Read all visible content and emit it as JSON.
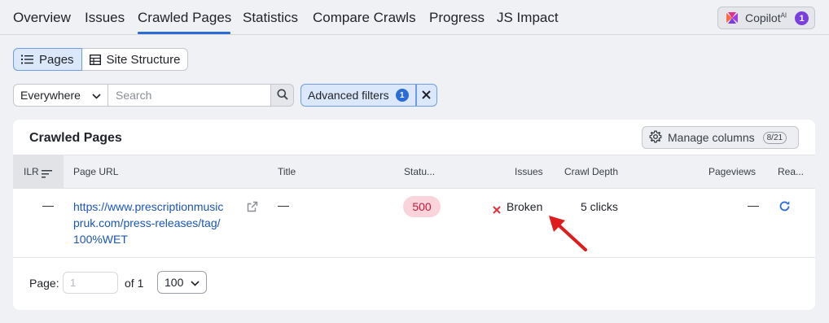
{
  "nav": {
    "tabs": [
      {
        "label": "Overview"
      },
      {
        "label": "Issues"
      },
      {
        "label": "Crawled Pages"
      },
      {
        "label": "Statistics"
      },
      {
        "label": "Compare Crawls"
      },
      {
        "label": "Progress"
      },
      {
        "label": "JS Impact"
      }
    ],
    "active_tab": "Crawled Pages",
    "copilot": {
      "label": "Copilot",
      "sup": "AI",
      "count": "1"
    }
  },
  "view_toggle": {
    "pages_label": "Pages",
    "site_structure_label": "Site Structure",
    "active": "Pages"
  },
  "filters": {
    "scope_value": "Everywhere",
    "search_placeholder": "Search",
    "advanced_label": "Advanced filters",
    "advanced_count": "1"
  },
  "card": {
    "title": "Crawled Pages",
    "manage_label": "Manage columns",
    "manage_count": "8/21"
  },
  "table": {
    "headers": {
      "ilr": "ILR",
      "url": "Page URL",
      "title": "Title",
      "status": "Statu...",
      "issues": "Issues",
      "depth": "Crawl Depth",
      "pageviews": "Pageviews",
      "recrawl": "Rea..."
    },
    "rows": [
      {
        "ilr": "—",
        "url_lines": [
          "https://www.prescriptionmusic",
          "pruk.com/press-releases/tag/",
          "100%WET"
        ],
        "title": "—",
        "status": "500",
        "issue": "Broken",
        "depth": "5 clicks",
        "pageviews": "—"
      }
    ]
  },
  "pagination": {
    "page_label": "Page:",
    "page_placeholder": "1",
    "of_label": "of 1",
    "per_page": "100"
  },
  "colors": {
    "accent": "#2a6bd8",
    "status_bg": "#fbd3da",
    "status_text": "#c21a3a",
    "arrow": "#e01b1b",
    "copilot_badge": "#7a3ee0"
  }
}
